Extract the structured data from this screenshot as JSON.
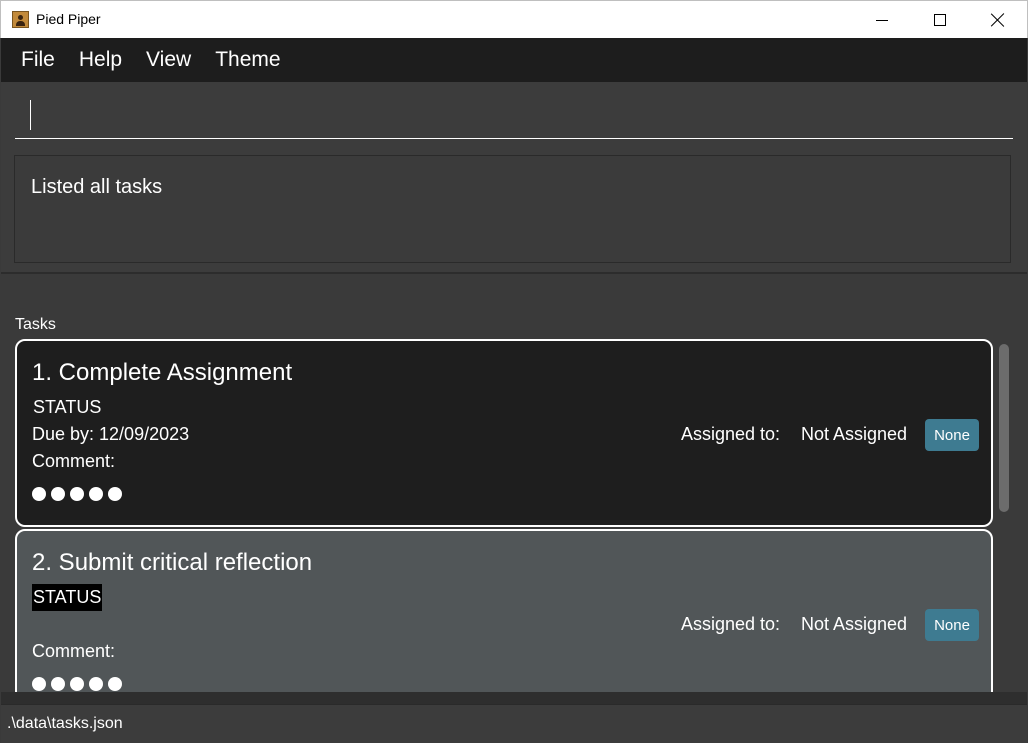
{
  "window": {
    "title": "Pied Piper",
    "icon": "app-icon"
  },
  "menu": {
    "items": [
      "File",
      "Help",
      "View",
      "Theme"
    ]
  },
  "command": {
    "value": ""
  },
  "result": {
    "message": "Listed all tasks"
  },
  "task_list": {
    "label": "Tasks",
    "tasks": [
      {
        "title": "1. Complete Assignment",
        "status": "STATUS",
        "due": "Due by: 12/09/2023",
        "comment_label": "Comment:",
        "assigned_label": "Assigned to:",
        "assignee": "Not Assigned",
        "tag": "None"
      },
      {
        "title": "2. Submit critical reflection",
        "status": "STATUS",
        "due": "",
        "comment_label": "Comment:",
        "assigned_label": "Assigned to:",
        "assignee": "Not Assigned",
        "tag": "None"
      }
    ]
  },
  "status_bar": {
    "path": ".\\data\\tasks.json"
  },
  "colors": {
    "background": "#3a3a3a",
    "menu_bar": "#1d1d1d",
    "selected_card": "#1e1e1e",
    "card": "#515658",
    "tag": "#3e7b91"
  }
}
